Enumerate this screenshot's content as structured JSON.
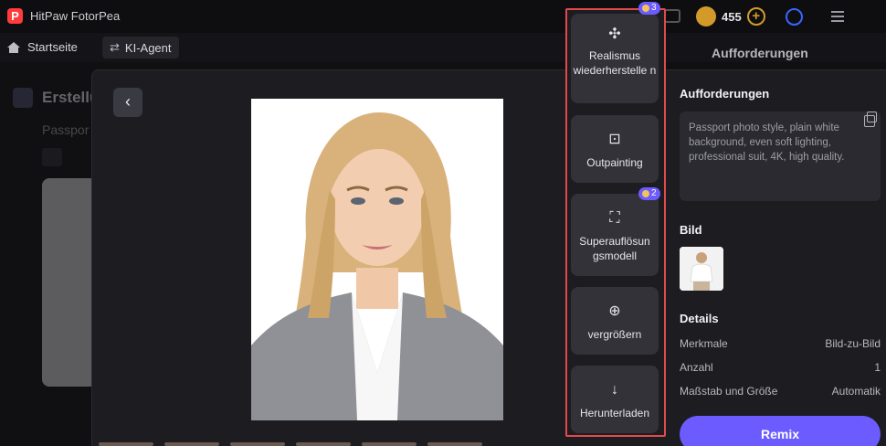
{
  "app": {
    "title": "HitPaw FotorPea",
    "logo_letter": "P",
    "credits": "455"
  },
  "nav": {
    "home_label": "Startseite",
    "agent_label": "KI-Agent",
    "swap_glyph": "⇄"
  },
  "background": {
    "title": "Erstellu",
    "subtitle": "Passpor",
    "right_title": "Aufforderungen"
  },
  "modal": {
    "back_glyph": "‹",
    "tools": [
      {
        "name": "realism",
        "label": "Realismus wiederherstelle n",
        "icon": "sparkle-icon",
        "glyph": "✣",
        "badge": "3"
      },
      {
        "name": "outpainting",
        "label": "Outpainting",
        "icon": "image-expand-icon",
        "glyph": "⊡"
      },
      {
        "name": "superres",
        "label": "Superauflösun gsmodell",
        "icon": "expand-corners-icon",
        "glyph": "⛶",
        "badge": "2"
      },
      {
        "name": "zoom",
        "label": "vergrößern",
        "icon": "zoom-in-icon",
        "glyph": "⊕"
      },
      {
        "name": "download",
        "label": "Herunterladen",
        "icon": "download-arrow-icon",
        "glyph": "↓"
      }
    ]
  },
  "panel": {
    "prompt_heading": "Aufforderungen",
    "prompt_text": "Passport photo style, plain white background, even soft lighting, professional suit, 4K, high quality.",
    "image_heading": "Bild",
    "details_heading": "Details",
    "details": [
      {
        "label": "Merkmale",
        "value": "Bild-zu-Bild"
      },
      {
        "label": "Anzahl",
        "value": "1"
      },
      {
        "label": "Maßstab und Größe",
        "value": "Automatik"
      }
    ],
    "remix_label": "Remix"
  },
  "colors": {
    "accent": "#6c5cff",
    "highlight_frame": "#e24a4a",
    "coin": "#d39a2a"
  }
}
